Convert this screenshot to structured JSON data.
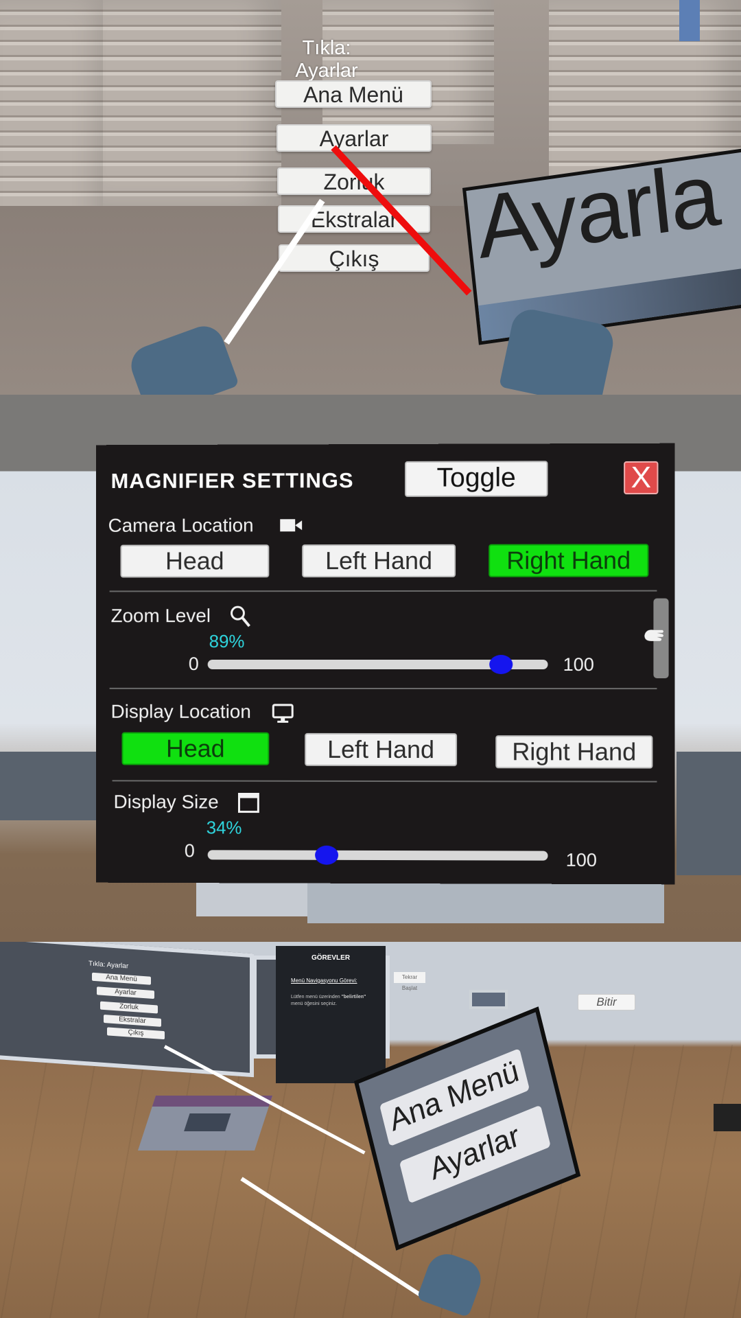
{
  "top_scene": {
    "prompt": "Tıkla: Ayarlar",
    "menu": [
      "Ana Menü",
      "Ayarlar",
      "Zorluk",
      "Ekstralar",
      "Çıkış"
    ],
    "magnified_text": "Ayarla"
  },
  "settings": {
    "title": "MAGNIFIER SETTINGS",
    "toggle_label": "Toggle",
    "close_label": "X",
    "camera": {
      "label": "Camera Location",
      "options": [
        "Head",
        "Left Hand",
        "Right Hand"
      ],
      "selected": "Right Hand"
    },
    "zoom": {
      "label": "Zoom Level",
      "value_text": "89%",
      "value": 89,
      "min": "0",
      "max": "100"
    },
    "display_location": {
      "label": "Display Location",
      "options": [
        "Head",
        "Left Hand",
        "Right Hand"
      ],
      "selected": "Head"
    },
    "display_size": {
      "label": "Display Size",
      "value_text": "34%",
      "value": 34,
      "min": "0",
      "max": "100"
    },
    "colors": {
      "active": "#10e010",
      "knob": "#1515ee",
      "percent": "#2fd6df",
      "close": "#e04a4a"
    }
  },
  "bottom_scene": {
    "mini_prompt": "Tıkla: Ayarlar",
    "mini_menu": [
      "Ana Menü",
      "Ayarlar",
      "Zorluk",
      "Ekstralar",
      "Çıkış"
    ],
    "board_title": "GÖREVLER",
    "board_subtitle": "Menü Navigasyonu Görevi:",
    "board_text_pre": "Lütfen menü üzerinden ",
    "board_text_bold": "\"belirtilen\"",
    "board_text_post": " menü öğesini seçiniz.",
    "restart_label": "Tekrar Başlat",
    "finish_label": "Bitir",
    "magnified_buttons": [
      "Ana Menü",
      "Ayarlar"
    ]
  }
}
